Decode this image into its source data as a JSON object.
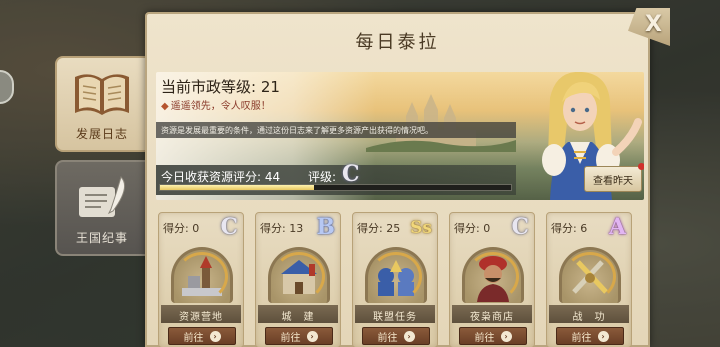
{
  "panel": {
    "title": "每日泰拉",
    "close_label": "X"
  },
  "side_tabs": [
    {
      "label": "发展日志",
      "active": true,
      "icon": "book-icon"
    },
    {
      "label": "王国纪事",
      "active": false,
      "icon": "quill-icon"
    }
  ],
  "banner": {
    "level_text": "当前市政等级: 21",
    "lead_text": "遥遥领先，令人叹服！",
    "description": "资源是发展最重要的条件，通过这份日志来了解更多资源产出获得的情况吧。",
    "score_label": "今日收获资源评分: 44",
    "rating_label": "评级:",
    "rating_grade": "C",
    "yesterday_button": "查看昨天"
  },
  "cards": [
    {
      "score_label": "得分: 0",
      "grade": "C",
      "name": "资源营地",
      "go_label": "前往",
      "icon": "resource-camp-icon"
    },
    {
      "score_label": "得分: 13",
      "grade": "B",
      "name": "城　建",
      "go_label": "前往",
      "icon": "city-building-icon"
    },
    {
      "score_label": "得分: 25",
      "grade": "Ss",
      "name": "联盟任务",
      "go_label": "前往",
      "icon": "alliance-task-icon"
    },
    {
      "score_label": "得分: 0",
      "grade": "C",
      "name": "夜枭商店",
      "go_label": "前往",
      "icon": "merchant-icon"
    },
    {
      "score_label": "得分: 6",
      "grade": "A",
      "name": "战　功",
      "go_label": "前往",
      "icon": "crossed-swords-icon"
    }
  ],
  "colors": {
    "panel_bg": "#efe4cc",
    "go_button": "#7a4a30",
    "progress_fill": "#f5e08a"
  },
  "progress": {
    "fraction": 0.44
  }
}
